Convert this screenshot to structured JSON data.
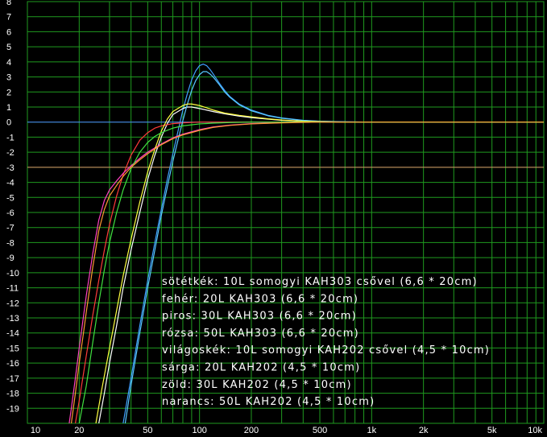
{
  "chart_data": {
    "type": "line",
    "title": "",
    "xlabel": "",
    "ylabel": "",
    "x_scale": "log",
    "xlim": [
      10,
      10000
    ],
    "ylim": [
      -20,
      8
    ],
    "grid": true,
    "x_tick_labels": [
      {
        "value": 10,
        "label": "10"
      },
      {
        "value": 20,
        "label": "20"
      },
      {
        "value": 50,
        "label": "50"
      },
      {
        "value": 100,
        "label": "100"
      },
      {
        "value": 200,
        "label": "200"
      },
      {
        "value": 500,
        "label": "500"
      },
      {
        "value": 1000,
        "label": "1k"
      },
      {
        "value": 2000,
        "label": "2k"
      },
      {
        "value": 5000,
        "label": "5k"
      },
      {
        "value": 10000,
        "label": "10k"
      }
    ],
    "y_ticks": [
      8,
      7,
      6,
      5,
      4,
      3,
      2,
      1,
      0,
      -1,
      -2,
      -3,
      -4,
      -5,
      -6,
      -7,
      -8,
      -9,
      -10,
      -11,
      -12,
      -13,
      -14,
      -15,
      -16,
      -17,
      -18,
      -19
    ],
    "reference_lines": [
      {
        "y": 0,
        "color": "#4a7cff"
      },
      {
        "y": -3,
        "color": "#d8906a"
      }
    ],
    "series": [
      {
        "name": "sötétkék: 10L somogyi KAH303 csővel (6,6 * 20cm)",
        "color": "#3fa0ff",
        "x": [
          36,
          40,
          45,
          50,
          55,
          60,
          65,
          70,
          75,
          80,
          85,
          90,
          95,
          100,
          105,
          110,
          115,
          120,
          130,
          140,
          150,
          170,
          200,
          250,
          300,
          400,
          500,
          700,
          1000,
          2000,
          5000,
          10000
        ],
        "y": [
          -20,
          -17,
          -13.5,
          -10.5,
          -8,
          -5.8,
          -3.8,
          -2.1,
          -0.6,
          0.8,
          1.9,
          2.8,
          3.4,
          3.75,
          3.85,
          3.75,
          3.5,
          3.2,
          2.6,
          2.1,
          1.7,
          1.2,
          0.8,
          0.45,
          0.28,
          0.12,
          0.06,
          0.02,
          0,
          0,
          0,
          0
        ]
      },
      {
        "name": "fehér: 20L KAH303 (6,6 * 20cm)",
        "color": "#ffffff",
        "x": [
          26,
          28,
          30,
          33,
          36,
          40,
          45,
          50,
          55,
          60,
          65,
          70,
          80,
          85,
          90,
          100,
          110,
          120,
          140,
          170,
          200,
          250,
          300,
          400,
          500,
          700,
          1000,
          2000,
          5000,
          10000
        ],
        "y": [
          -20,
          -18,
          -16,
          -13.5,
          -11,
          -8.5,
          -6,
          -3.8,
          -2.2,
          -1,
          -0.1,
          0.5,
          0.9,
          1,
          1,
          0.9,
          0.8,
          0.7,
          0.55,
          0.4,
          0.3,
          0.2,
          0.12,
          0.05,
          0.02,
          0,
          0,
          0,
          0,
          0
        ]
      },
      {
        "name": "piros: 30L KAH303 (6,6 * 20cm)",
        "color": "#ff3a3a",
        "x": [
          19,
          20,
          22,
          24,
          26,
          28,
          30,
          33,
          36,
          40,
          45,
          50,
          55,
          60,
          70,
          80,
          100,
          120,
          150,
          200,
          300,
          500,
          1000,
          2000,
          10000
        ],
        "y": [
          -20,
          -18.5,
          -15.5,
          -12.8,
          -10.5,
          -8.5,
          -6.8,
          -4.9,
          -3.5,
          -2.2,
          -1.2,
          -0.7,
          -0.4,
          -0.25,
          -0.1,
          -0.05,
          0,
          0,
          0,
          0,
          0,
          0,
          0,
          0,
          0
        ]
      },
      {
        "name": "rózsa: 50L KAH303 (6,6 * 20cm)",
        "color": "#ff40c0",
        "x": [
          17.5,
          18,
          19,
          20,
          21,
          22,
          24,
          26,
          28,
          30,
          33,
          36,
          40,
          45,
          50,
          60,
          70,
          80,
          100,
          120,
          150,
          200,
          300,
          500,
          1000,
          2000,
          10000
        ],
        "y": [
          -20,
          -19,
          -17,
          -15,
          -13.2,
          -11.5,
          -8.7,
          -6.5,
          -5.2,
          -4.5,
          -3.9,
          -3.4,
          -2.9,
          -2.4,
          -2.0,
          -1.45,
          -1.05,
          -0.8,
          -0.5,
          -0.32,
          -0.2,
          -0.1,
          -0.04,
          0,
          0,
          0,
          0
        ]
      },
      {
        "name": "világoskék: 10L somogyi KAH202 csővel (4,5 * 10cm)",
        "color": "#58c8ff",
        "x": [
          37,
          40,
          45,
          50,
          55,
          60,
          65,
          70,
          75,
          80,
          85,
          90,
          95,
          100,
          105,
          110,
          115,
          120,
          130,
          140,
          150,
          170,
          200,
          250,
          300,
          400,
          500,
          700,
          1000,
          2000,
          5000,
          10000
        ],
        "y": [
          -20,
          -17.5,
          -14,
          -11,
          -8.5,
          -6.2,
          -4.3,
          -2.6,
          -1.2,
          0.1,
          1.2,
          2.1,
          2.75,
          3.15,
          3.35,
          3.35,
          3.2,
          3.0,
          2.5,
          2.0,
          1.65,
          1.15,
          0.75,
          0.42,
          0.26,
          0.11,
          0.05,
          0.02,
          0,
          0,
          0,
          0
        ]
      },
      {
        "name": "sárga: 20L KAH202 (4,5 * 10cm)",
        "color": "#ffff40",
        "x": [
          25,
          27,
          30,
          33,
          36,
          40,
          45,
          50,
          55,
          60,
          65,
          70,
          80,
          85,
          90,
          100,
          110,
          120,
          140,
          170,
          200,
          250,
          300,
          400,
          500,
          700,
          1000,
          2000,
          5000,
          10000
        ],
        "y": [
          -20,
          -17.8,
          -15,
          -12.5,
          -10.2,
          -7.8,
          -5.3,
          -3.3,
          -1.8,
          -0.6,
          0.2,
          0.7,
          1.1,
          1.2,
          1.2,
          1.1,
          0.95,
          0.8,
          0.6,
          0.45,
          0.35,
          0.22,
          0.14,
          0.06,
          0.03,
          0,
          0,
          0,
          0,
          0
        ]
      },
      {
        "name": "zöld: 30L KAH202 (4,5 * 10cm)",
        "color": "#40e040",
        "x": [
          20,
          22,
          24,
          26,
          28,
          30,
          33,
          36,
          40,
          45,
          50,
          55,
          60,
          70,
          80,
          100,
          120,
          150,
          200,
          300,
          500,
          1000,
          2000,
          10000
        ],
        "y": [
          -20,
          -17.5,
          -14.6,
          -12,
          -9.8,
          -8.0,
          -6.0,
          -4.5,
          -3.1,
          -2.0,
          -1.35,
          -0.95,
          -0.7,
          -0.4,
          -0.25,
          -0.12,
          -0.07,
          -0.03,
          0,
          0,
          0,
          0,
          0,
          0
        ]
      },
      {
        "name": "narancs: 50L KAH202 (4,5 * 10cm)",
        "color": "#ff9933",
        "x": [
          18,
          19,
          20,
          21,
          22,
          24,
          26,
          28,
          30,
          33,
          36,
          40,
          45,
          50,
          60,
          70,
          80,
          100,
          120,
          150,
          200,
          300,
          500,
          1000,
          2000,
          10000
        ],
        "y": [
          -20,
          -18,
          -16,
          -14.3,
          -12.6,
          -9.6,
          -7.2,
          -5.8,
          -4.9,
          -4.2,
          -3.6,
          -3.0,
          -2.5,
          -2.1,
          -1.5,
          -1.1,
          -0.85,
          -0.55,
          -0.35,
          -0.22,
          -0.12,
          -0.05,
          0,
          0,
          0,
          0
        ]
      }
    ]
  }
}
